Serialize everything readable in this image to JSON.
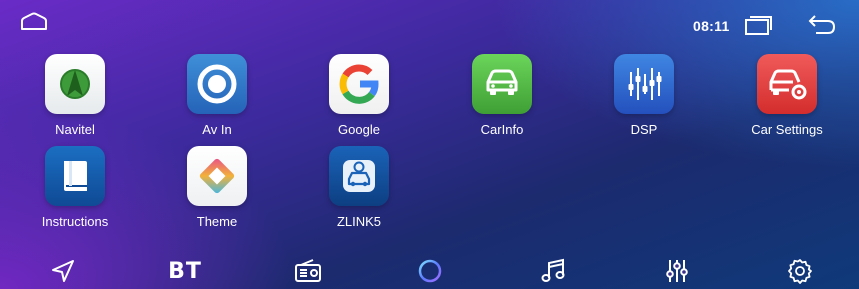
{
  "status_bar": {
    "time": "08:11"
  },
  "apps": [
    {
      "label": "Navitel",
      "icon": "navitel-icon"
    },
    {
      "label": "Av In",
      "icon": "av-in-icon"
    },
    {
      "label": "Google",
      "icon": "google-icon"
    },
    {
      "label": "CarInfo",
      "icon": "car-info-icon"
    },
    {
      "label": "DSP",
      "icon": "dsp-icon"
    },
    {
      "label": "Car Settings",
      "icon": "car-settings-icon"
    },
    {
      "label": "Instructions",
      "icon": "instructions-icon"
    },
    {
      "label": "Theme",
      "icon": "theme-icon"
    },
    {
      "label": "ZLINK5",
      "icon": "zlink-icon"
    }
  ],
  "dock": {
    "bt_label": "BT",
    "items": [
      "navigation-icon",
      "bluetooth",
      "radio-icon",
      "assistant-icon",
      "music-icon",
      "equalizer-icon",
      "settings-icon"
    ]
  },
  "colors": {
    "accent_blue": "#2f7fd6",
    "accent_purple": "#6a2bc7"
  }
}
